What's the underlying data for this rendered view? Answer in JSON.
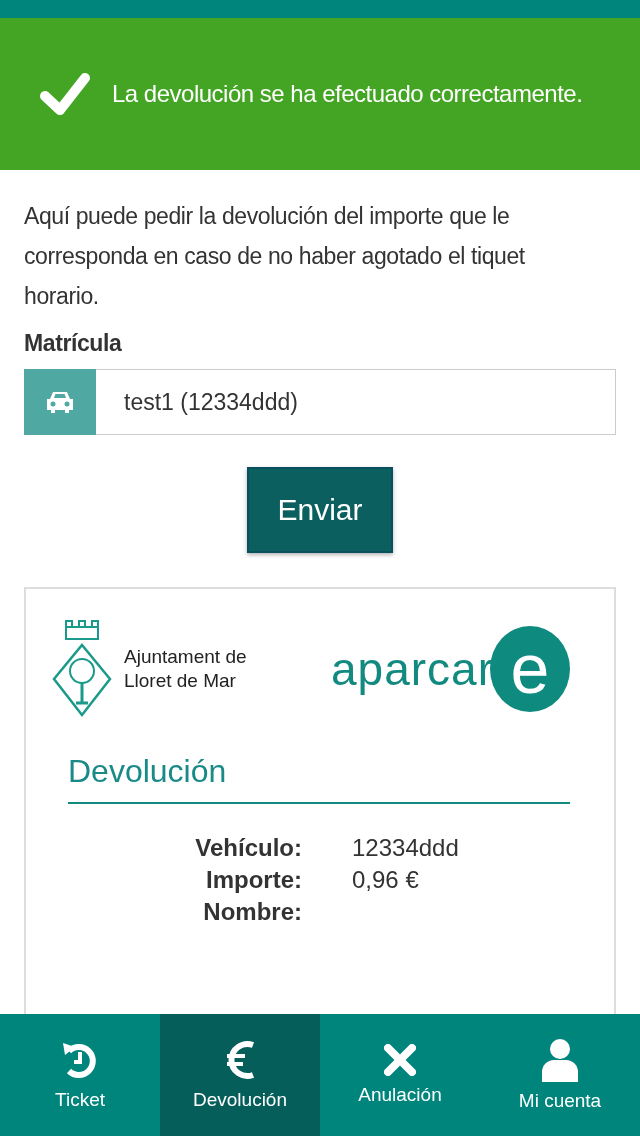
{
  "alert": {
    "message": "La devolución se ha efectuado correctamente."
  },
  "intro": "Aquí puede pedir la devolución del importe que le corresponda en caso de no haber agotado el tiquet horario.",
  "plate": {
    "label": "Matrícula",
    "value": "test1 (12334ddd)"
  },
  "submit": "Enviar",
  "receipt": {
    "council": [
      "Ajuntament de",
      "Lloret de Mar"
    ],
    "brand": "aparcar",
    "brand_mark": "e",
    "title": "Devolución",
    "rows": [
      {
        "label": "Vehículo:",
        "value": "12334ddd"
      },
      {
        "label": "Importe:",
        "value": "0,96 €"
      },
      {
        "label": "Nombre:"
      }
    ]
  },
  "nav": [
    {
      "kind": "ticket",
      "label": "Ticket",
      "selected": false
    },
    {
      "kind": "refund",
      "label": "Devolución",
      "selected": true
    },
    {
      "kind": "cancel",
      "label": "Anulación",
      "selected": false
    },
    {
      "kind": "account",
      "label": "Mi cuenta",
      "selected": false
    }
  ]
}
